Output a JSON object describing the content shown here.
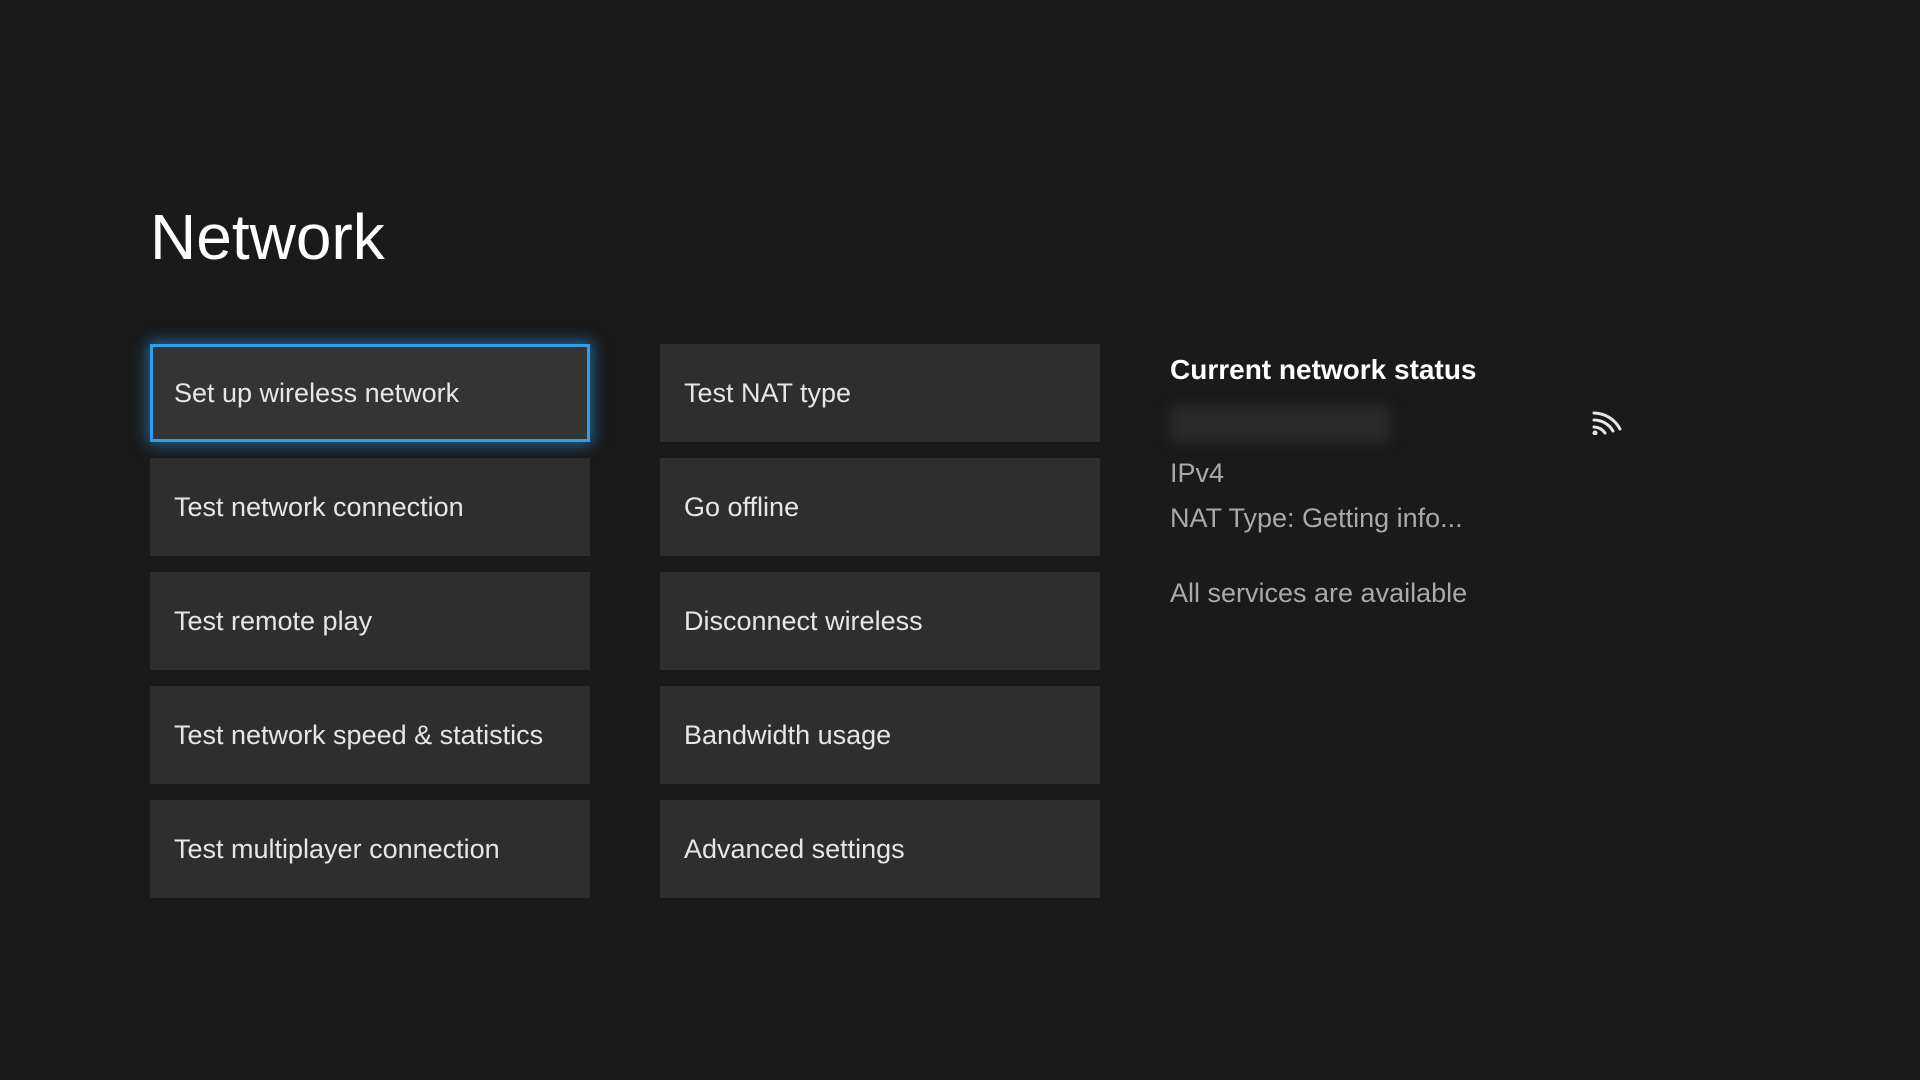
{
  "page": {
    "title": "Network"
  },
  "menu": {
    "col1": [
      {
        "label": "Set up wireless network"
      },
      {
        "label": "Test network connection"
      },
      {
        "label": "Test remote play"
      },
      {
        "label": "Test network speed & statistics"
      },
      {
        "label": "Test multiplayer connection"
      }
    ],
    "col2": [
      {
        "label": "Test NAT type"
      },
      {
        "label": "Go offline"
      },
      {
        "label": "Disconnect wireless"
      },
      {
        "label": "Bandwidth usage"
      },
      {
        "label": "Advanced settings"
      }
    ]
  },
  "status": {
    "heading": "Current network status",
    "ip_version": "IPv4",
    "nat_type": "NAT Type: Getting info...",
    "services": "All services are available"
  }
}
